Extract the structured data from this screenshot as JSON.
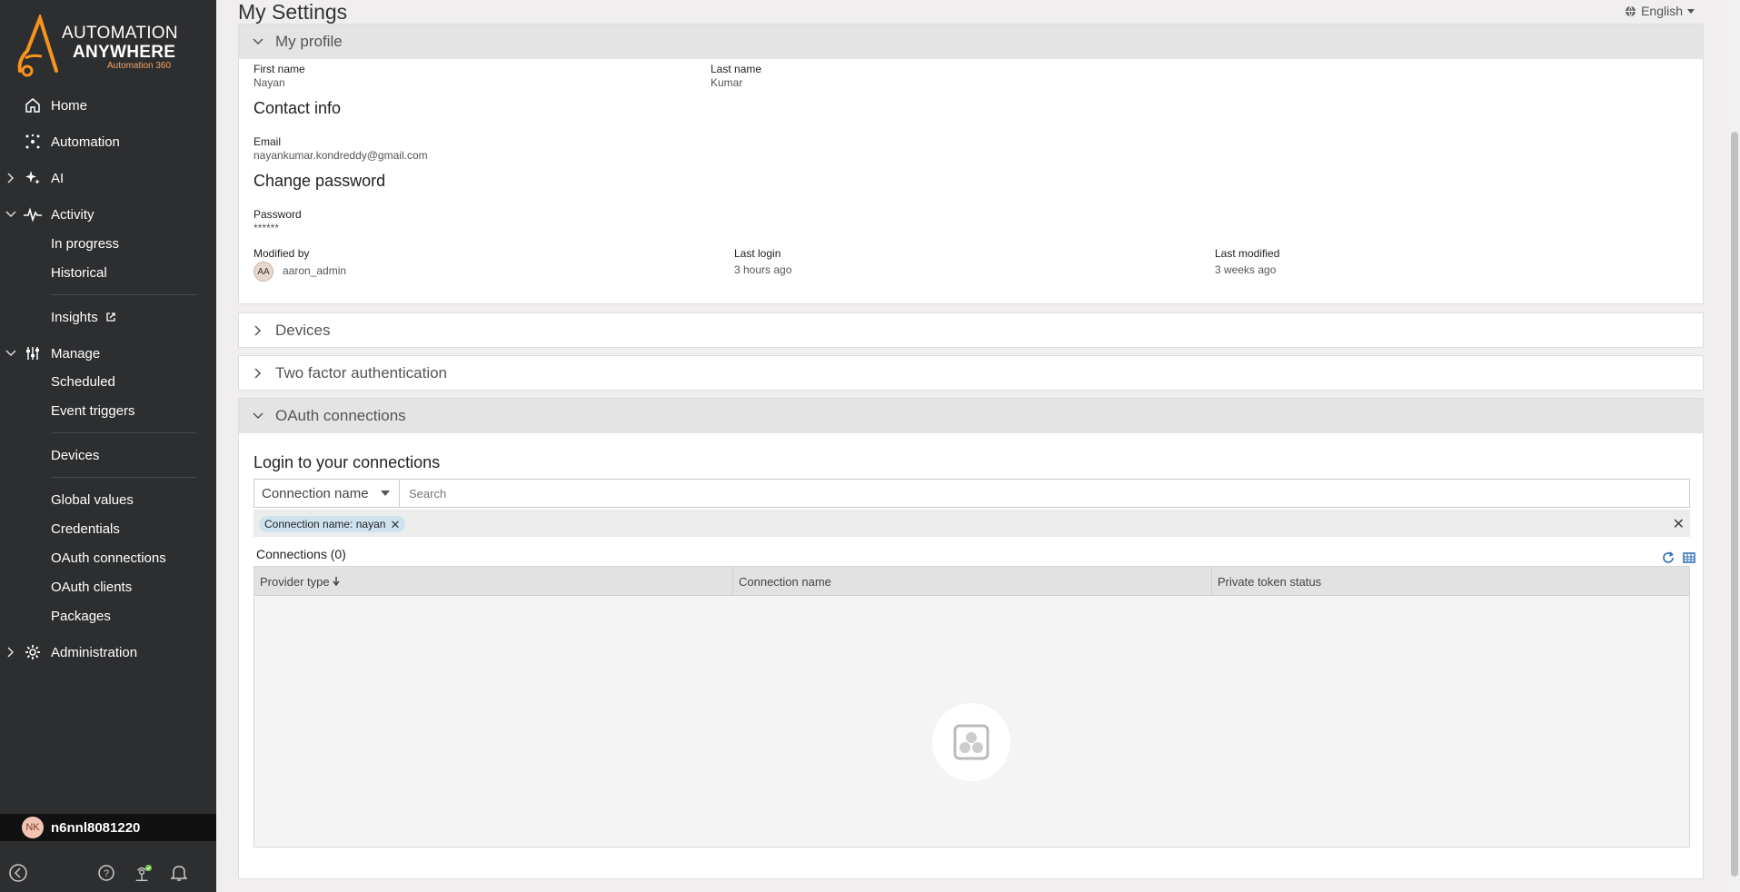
{
  "brand": {
    "line1": "AUTOMATION",
    "line2": "ANYWHERE",
    "line3": "Automation 360",
    "accent_color": "#f7941d"
  },
  "sidebar": {
    "items": [
      {
        "label": "Home",
        "icon": "home-icon"
      },
      {
        "label": "Automation",
        "icon": "automation-icon"
      },
      {
        "label": "AI",
        "icon": "ai-sparkle-icon"
      },
      {
        "label": "Activity",
        "icon": "activity-pulse-icon"
      },
      {
        "label": "Manage",
        "icon": "sliders-icon"
      },
      {
        "label": "Administration",
        "icon": "gear-icon"
      }
    ],
    "activity_sub": [
      "In progress",
      "Historical"
    ],
    "insights": "Insights",
    "manage_sub": [
      "Scheduled",
      "Event triggers",
      "Devices",
      "Global values",
      "Credentials",
      "OAuth connections",
      "OAuth clients",
      "Packages"
    ],
    "user_initials": "NK",
    "user_name": "n6nnl8081220"
  },
  "header": {
    "title": "My Settings",
    "language": "English"
  },
  "profile": {
    "section_title": "My profile",
    "first_name_label": "First name",
    "first_name": "Nayan",
    "last_name_label": "Last name",
    "last_name": "Kumar",
    "contact_heading": "Contact info",
    "email_label": "Email",
    "email": "nayankumar.kondreddy@gmail.com",
    "password_heading": "Change password",
    "password_label": "Password",
    "password": "******",
    "modified_by_label": "Modified by",
    "modified_by_initials": "AA",
    "modified_by": "aaron_admin",
    "last_login_label": "Last login",
    "last_login": "3 hours ago",
    "last_modified_label": "Last modified",
    "last_modified": "3 weeks ago"
  },
  "panels": {
    "devices": "Devices",
    "two_factor": "Two factor authentication",
    "oauth": "OAuth connections"
  },
  "oauth": {
    "heading": "Login to your connections",
    "filter_select": "Connection name",
    "search_placeholder": "Search",
    "chip": "Connection name: nayan",
    "connections_count": "Connections (0)",
    "columns": [
      "Provider type",
      "Connection name",
      "Private token status"
    ]
  }
}
